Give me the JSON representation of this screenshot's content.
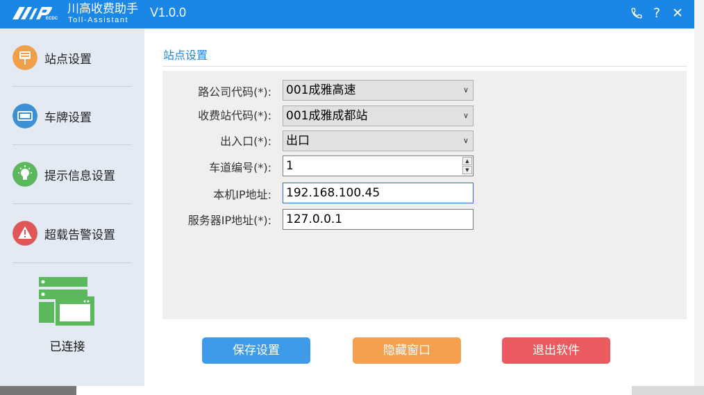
{
  "app": {
    "logo_text": "ECDC",
    "name": "川高收费助手",
    "subtitle": "Toll-Assistant",
    "version": "V1.0.0"
  },
  "titlebar_icons": [
    "phone-icon",
    "help-icon",
    "close-icon"
  ],
  "titlebar_glyphs": {
    "help": "?",
    "close": "✕"
  },
  "sidebar": {
    "items": [
      {
        "label": "站点设置",
        "icon": "station-sign-icon",
        "color": "#f0a04b"
      },
      {
        "label": "车牌设置",
        "icon": "license-plate-icon",
        "color": "#3d8fd6"
      },
      {
        "label": "提示信息设置",
        "icon": "lightbulb-icon",
        "color": "#5cb85c"
      },
      {
        "label": "超载告警设置",
        "icon": "warning-icon",
        "color": "#e05757"
      }
    ],
    "connection_status": "已连接",
    "connection_icon": "server-window-icon"
  },
  "content": {
    "section_title": "站点设置",
    "fields": {
      "road_company": {
        "label": "路公司代码(*):",
        "value": "001成雅高速"
      },
      "toll_station": {
        "label": "收费站代码(*):",
        "value": "001成雅成都站"
      },
      "entry_exit": {
        "label": "出入口(*):",
        "value": "出口"
      },
      "lane_number": {
        "label": "车道编号(*):",
        "value": "1"
      },
      "local_ip": {
        "label": "本机IP地址:",
        "value": "192.168.100.45"
      },
      "server_ip": {
        "label": "服务器IP地址(*):",
        "value": "127.0.0.1"
      }
    },
    "buttons": {
      "save": {
        "label": "保存设置",
        "color": "#3d9be9"
      },
      "hide": {
        "label": "隐藏窗口",
        "color": "#f5a04f"
      },
      "exit": {
        "label": "退出软件",
        "color": "#ea5a5e"
      }
    }
  },
  "colors": {
    "titlebar": "#1a87e6",
    "sidebar_bg": "#e3eaf3",
    "accent": "#1a87e6"
  }
}
